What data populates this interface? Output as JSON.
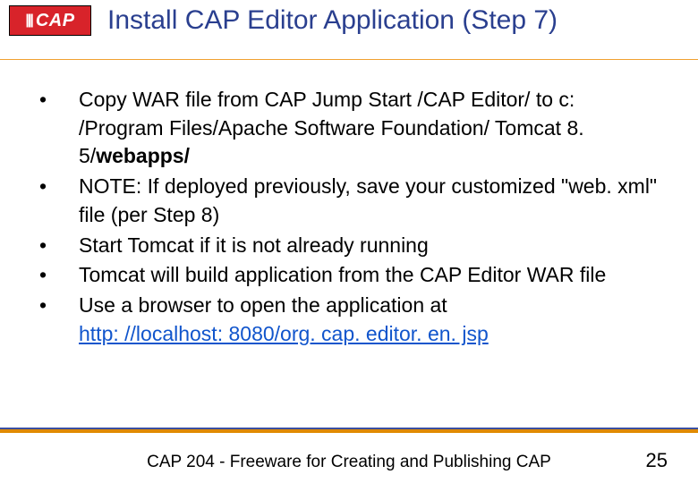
{
  "logo": {
    "text": "CAP",
    "bars": "|||"
  },
  "title": "Install CAP Editor Application (Step 7)",
  "bullets": [
    {
      "pre": "Copy WAR file from CAP Jump Start /CAP Editor/ to c: /Program Files/Apache Software Foundation/    Tomcat 8. 5/",
      "bold": "webapps/"
    },
    {
      "text": "NOTE: If deployed previously, save your customized \"web. xml\" file (per Step 8)"
    },
    {
      "text": "Start Tomcat if it is not already running"
    },
    {
      "text": "Tomcat will build application from the CAP Editor WAR file"
    },
    {
      "pre": "Use a browser to open the application at ",
      "link": "http: //localhost: 8080/org. cap. editor. en. jsp"
    }
  ],
  "footer": "CAP 204 - Freeware for Creating and Publishing CAP",
  "page": "25"
}
